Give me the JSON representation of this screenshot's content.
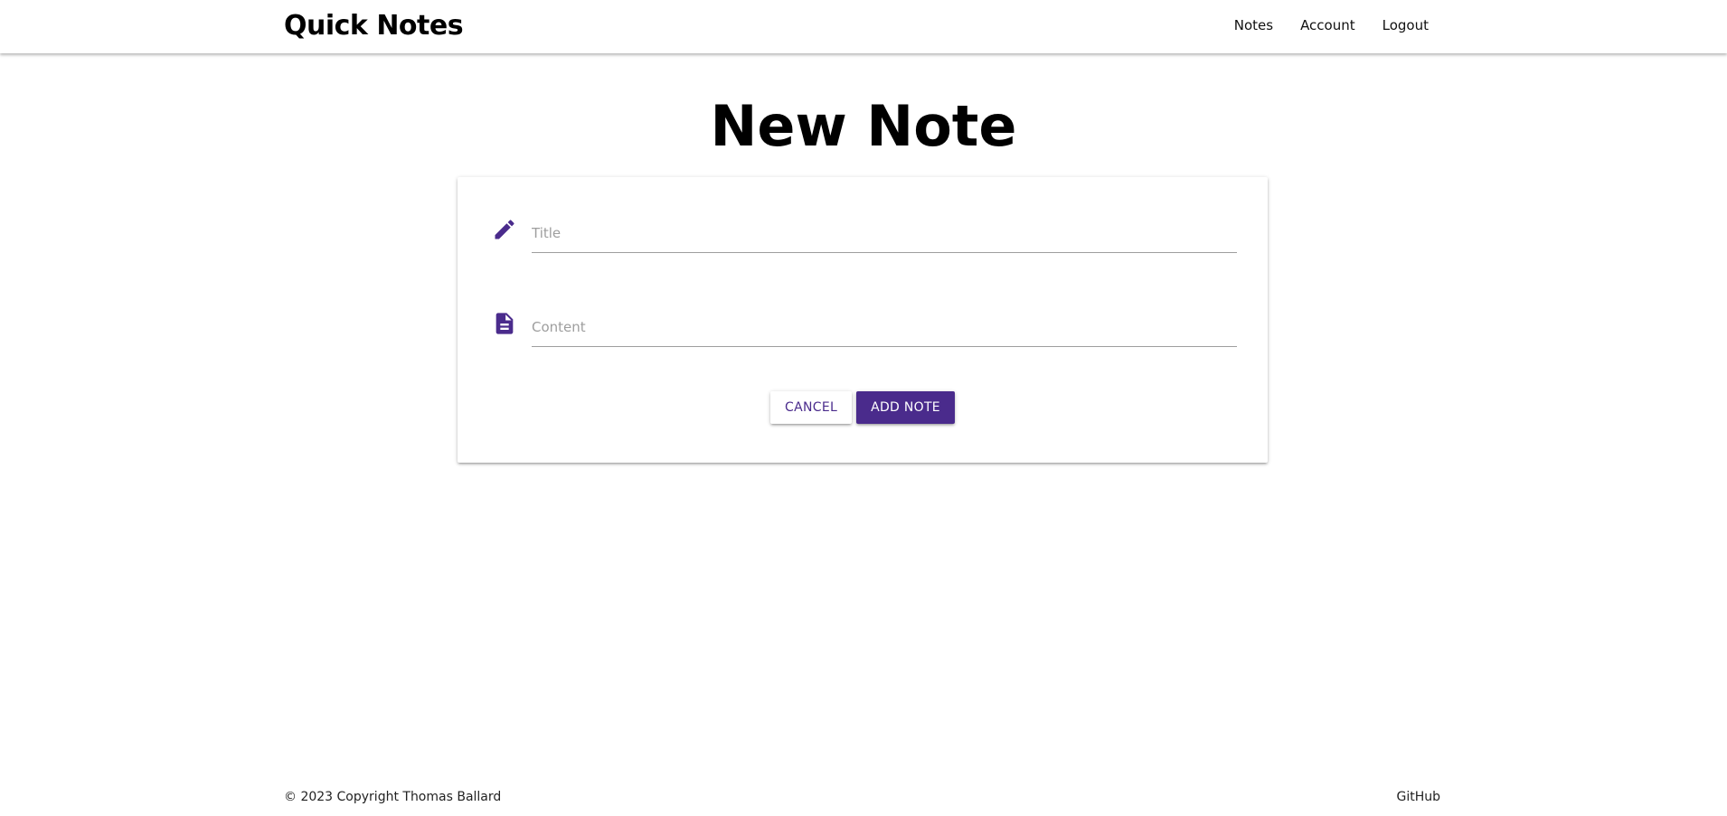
{
  "app": {
    "brand": "Quick Notes"
  },
  "nav": {
    "items": [
      {
        "label": "Notes"
      },
      {
        "label": "Account"
      },
      {
        "label": "Logout"
      }
    ]
  },
  "page": {
    "title": "New Note"
  },
  "form": {
    "title_field": {
      "icon": "pencil-icon",
      "placeholder": "Title",
      "value": ""
    },
    "content_field": {
      "icon": "document-icon",
      "placeholder": "Content",
      "value": ""
    },
    "cancel_label": "Cancel",
    "submit_label": "Add Note"
  },
  "footer": {
    "copyright": "© 2023 Copyright Thomas Ballard",
    "github_label": "GitHub"
  },
  "colors": {
    "accent": "#4a2b8c",
    "text": "#000000",
    "placeholder": "#9e9e9e",
    "underline": "#9e9e9e"
  }
}
